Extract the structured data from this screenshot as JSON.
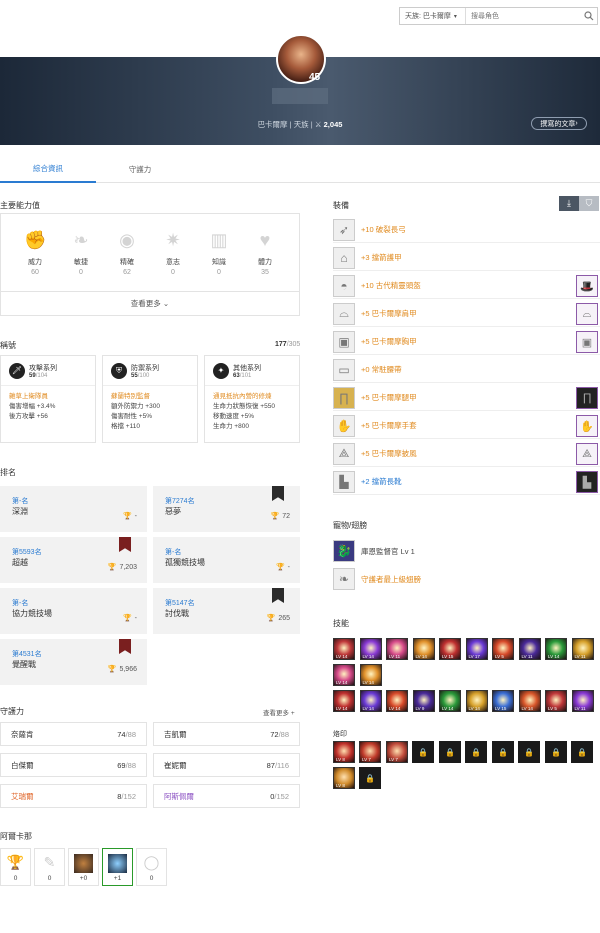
{
  "search": {
    "server": "天族: 巴卡爾摩",
    "placeholder": "搜尋角色"
  },
  "profile": {
    "level": "45",
    "server": "巴卡爾摩",
    "race": "天族",
    "score": "2,045",
    "written_label": "撰寫的文章"
  },
  "tabs": [
    "綜合資訊",
    "守護力"
  ],
  "stats": {
    "title": "主要能力值",
    "items": [
      {
        "name": "威力",
        "value": "60"
      },
      {
        "name": "敏捷",
        "value": "0"
      },
      {
        "name": "精確",
        "value": "62"
      },
      {
        "name": "意志",
        "value": "0"
      },
      {
        "name": "知識",
        "value": "0"
      },
      {
        "name": "體力",
        "value": "35"
      }
    ],
    "more": "查看更多"
  },
  "titles": {
    "title": "稱號",
    "count": "177",
    "total": "/305",
    "cards": [
      {
        "name": "攻擊系列",
        "count": "59",
        "total": "/104",
        "highlight": "雜草上衛隊員",
        "lines": [
          "傷害增幅 +3.4%",
          "後方攻擊 +56"
        ]
      },
      {
        "name": "防禦系列",
        "count": "55",
        "total": "/100",
        "highlight": "蘇蘭特別監督",
        "lines": [
          "額外防禦力 +300",
          "傷害耐性 +5%",
          "格擋 +110"
        ]
      },
      {
        "name": "其他系列",
        "count": "63",
        "total": "/101",
        "highlight": "通見抵抗內營的修煉",
        "lines": [
          "生命力狀態恢復 +550",
          "移動速度 +5%",
          "生命力 +800"
        ]
      }
    ]
  },
  "ranking": {
    "title": "排名",
    "cards": [
      {
        "rank": "第-名",
        "name": "深淵",
        "value": "-"
      },
      {
        "rank": "第7274名",
        "name": "惡夢",
        "value": "72"
      },
      {
        "rank": "第5593名",
        "name": "超越",
        "value": "7,203"
      },
      {
        "rank": "第-名",
        "name": "孤獨競技場",
        "value": "-"
      },
      {
        "rank": "第-名",
        "name": "協力競技場",
        "value": "-"
      },
      {
        "rank": "第5147名",
        "name": "討伐戰",
        "value": "265"
      },
      {
        "rank": "第4531名",
        "name": "覺醒戰",
        "value": "5,966"
      }
    ]
  },
  "guardian": {
    "title": "守護力",
    "more": "查看更多",
    "cells": [
      {
        "name": "奈薩肯",
        "value": "74",
        "max": "/88"
      },
      {
        "name": "吉凱爾",
        "value": "72",
        "max": "/88"
      },
      {
        "name": "白傑爾",
        "value": "69",
        "max": "/88"
      },
      {
        "name": "崔妮爾",
        "value": "87",
        "max": "/116"
      },
      {
        "name": "艾瑞爾",
        "value": "8",
        "max": "/152"
      },
      {
        "name": "阿斯佩爾",
        "value": "0",
        "max": "/152"
      }
    ]
  },
  "cards": {
    "title": "阿爾卡那",
    "values": [
      "0",
      "0",
      "+0",
      "+1",
      "0"
    ]
  },
  "equipment": {
    "title": "裝備",
    "items": [
      {
        "name": "+10 破裂長弓",
        "icon": "bow-icon"
      },
      {
        "name": "+3 擋箭護甲",
        "icon": "armguard-icon"
      },
      {
        "name": "+10 古代精靈頭盔",
        "icon": "helmet-icon"
      },
      {
        "name": "+5 巴卡爾摩肩甲",
        "icon": "shoulder-icon"
      },
      {
        "name": "+5 巴卡爾摩胸甲",
        "icon": "chest-icon"
      },
      {
        "name": "+0 常駐腰帶",
        "icon": "belt-icon"
      },
      {
        "name": "+5 巴卡爾摩腿甲",
        "icon": "legs-icon"
      },
      {
        "name": "+5 巴卡爾摩手套",
        "icon": "gloves-icon"
      },
      {
        "name": "+5 巴卡爾摩披風",
        "icon": "cape-icon"
      },
      {
        "name": "+2 擋箭長靴",
        "icon": "boots-icon",
        "blue": true
      }
    ]
  },
  "pet": {
    "title": "寵物/翅膀",
    "pet_name": "庫恩監督官 Lv 1",
    "wing_name": "守護者最上級翅膀"
  },
  "skills": {
    "title": "技能",
    "row1": [
      "LV 14",
      "LV 14",
      "LV 11",
      "LV 14",
      "LV 15",
      "LV 17",
      "LV 5",
      "LV 11",
      "LV 14",
      "LV 11"
    ],
    "row2": [
      "LV 14",
      "LV 14"
    ],
    "row3": [
      "LV 14",
      "LV 14",
      "LV 14",
      "LV 9",
      "LV 14",
      "LV 14",
      "LV 15",
      "LV 14",
      "LV 5",
      "LV 11"
    ]
  },
  "engraving": {
    "title": "烙印",
    "levels": [
      "LV 8",
      "LV 7",
      "LV 7",
      "LV 8"
    ]
  }
}
